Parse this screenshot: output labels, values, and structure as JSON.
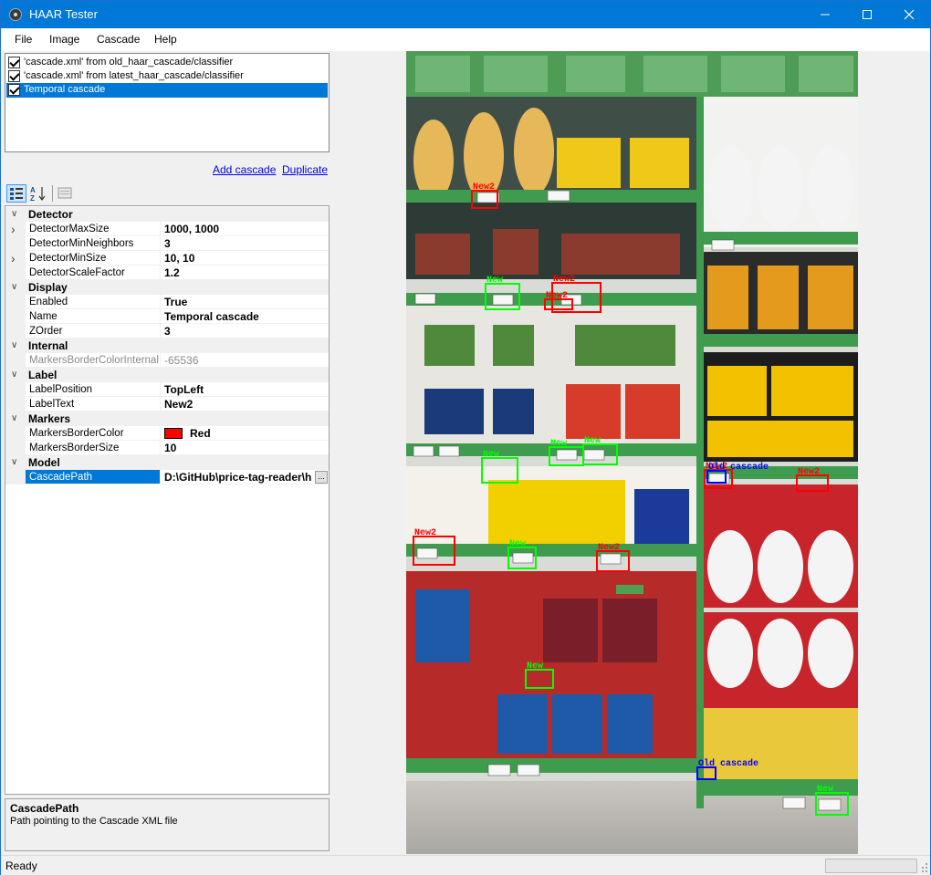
{
  "window": {
    "title": "HAAR Tester",
    "min_icon": "minimize-icon",
    "max_icon": "maximize-icon",
    "close_icon": "close-icon"
  },
  "menu": [
    "File",
    "Image",
    "Cascade",
    "Help"
  ],
  "cascades": [
    {
      "label": "'cascade.xml' from old_haar_cascade/classifier",
      "checked": true,
      "selected": false
    },
    {
      "label": "'cascade.xml' from latest_haar_cascade/classifier",
      "checked": true,
      "selected": false
    },
    {
      "label": "Temporal cascade",
      "checked": true,
      "selected": true
    }
  ],
  "links": {
    "add_cascade": "Add cascade",
    "duplicate": "Duplicate"
  },
  "property_grid": {
    "toolbar": {
      "categorized_icon": "categorized-icon",
      "alphabetical_icon": "alphabetical-sort-icon",
      "pages_icon": "property-pages-icon"
    },
    "categories": [
      {
        "name": "Detector",
        "props": [
          {
            "name": "DetectorMaxSize",
            "value": "1000, 1000",
            "expandable": true
          },
          {
            "name": "DetectorMinNeighbors",
            "value": "3"
          },
          {
            "name": "DetectorMinSize",
            "value": "10, 10",
            "expandable": true
          },
          {
            "name": "DetectorScaleFactor",
            "value": "1.2"
          }
        ]
      },
      {
        "name": "Display",
        "props": [
          {
            "name": "Enabled",
            "value": "True"
          },
          {
            "name": "Name",
            "value": "Temporal cascade"
          },
          {
            "name": "ZOrder",
            "value": "3"
          }
        ]
      },
      {
        "name": "Internal",
        "props": [
          {
            "name": "MarkersBorderColorInternal",
            "value": "-65536",
            "readonly": true
          }
        ]
      },
      {
        "name": "Label",
        "props": [
          {
            "name": "LabelPosition",
            "value": "TopLeft"
          },
          {
            "name": "LabelText",
            "value": "New2"
          }
        ]
      },
      {
        "name": "Markers",
        "props": [
          {
            "name": "MarkersBorderColor",
            "value": "Red",
            "color": "#ff0000"
          },
          {
            "name": "MarkersBorderSize",
            "value": "10"
          }
        ]
      },
      {
        "name": "Model",
        "props": [
          {
            "name": "CascadePath",
            "value": "D:\\GitHub\\price-tag-reader\\h",
            "selected": true,
            "button": "..."
          }
        ]
      }
    ]
  },
  "help": {
    "title": "CascadePath",
    "description": "Path pointing to the Cascade XML file"
  },
  "detections": [
    {
      "label": "New2",
      "color": "#ff0000"
    },
    {
      "label": "New2",
      "color": "#ff0000"
    },
    {
      "label": "New2",
      "color": "#ff0000"
    },
    {
      "label": "New2",
      "color": "#ff0000"
    },
    {
      "label": "New2",
      "color": "#ff0000"
    },
    {
      "label": "New2",
      "color": "#ff0000"
    },
    {
      "label": "New2",
      "color": "#ff0000"
    },
    {
      "label": "New",
      "color": "#00ff00"
    },
    {
      "label": "New",
      "color": "#00ff00"
    },
    {
      "label": "New",
      "color": "#00ff00"
    },
    {
      "label": "New",
      "color": "#00ff00"
    },
    {
      "label": "New",
      "color": "#00ff00"
    },
    {
      "label": "New",
      "color": "#00ff00"
    },
    {
      "label": "New",
      "color": "#00ff00"
    },
    {
      "label": "Old cascade",
      "color": "#0000ff"
    },
    {
      "label": "Old cascade",
      "color": "#0000ff"
    }
  ],
  "status": {
    "text": "Ready"
  }
}
